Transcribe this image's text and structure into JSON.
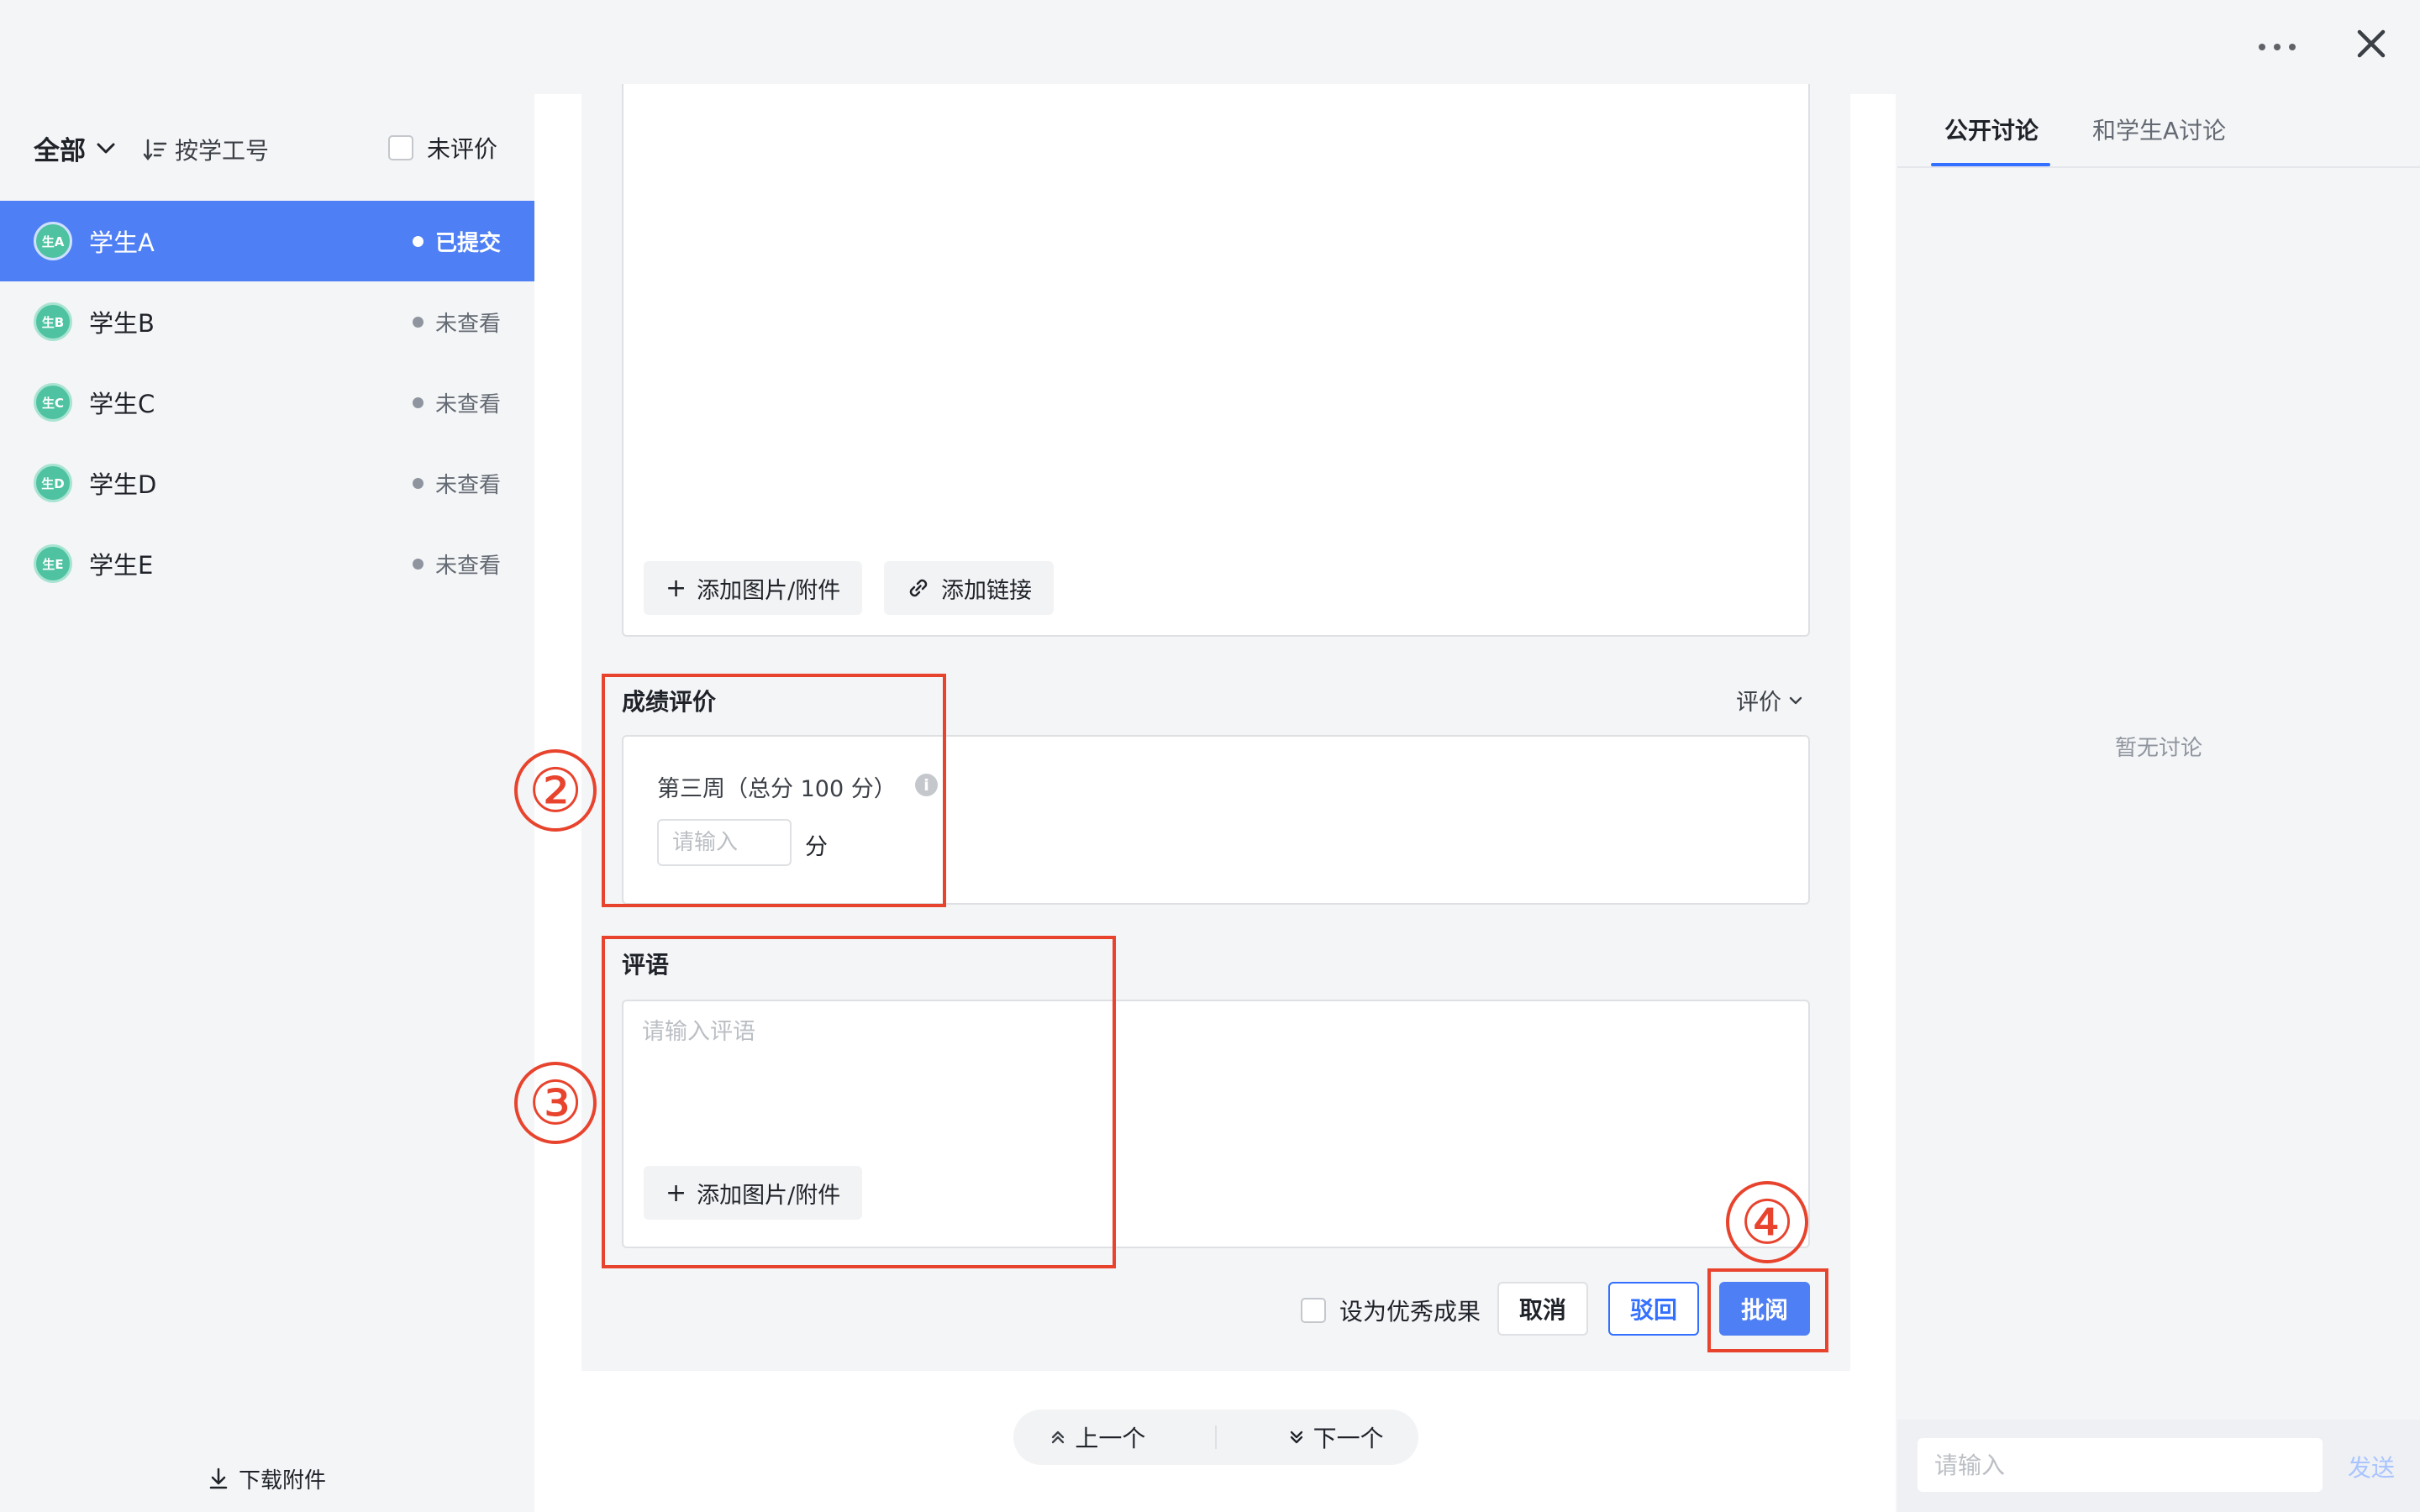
{
  "sidebar": {
    "filter_label": "全部",
    "sort_label": "按学工号",
    "unreviewed_label": "未评价",
    "students": [
      {
        "avatar": "生A",
        "name": "学生A",
        "status": "已提交"
      },
      {
        "avatar": "生B",
        "name": "学生B",
        "status": "未查看"
      },
      {
        "avatar": "生C",
        "name": "学生C",
        "status": "未查看"
      },
      {
        "avatar": "生D",
        "name": "学生D",
        "status": "未查看"
      },
      {
        "avatar": "生E",
        "name": "学生E",
        "status": "未查看"
      }
    ],
    "download_label": "下载附件"
  },
  "editor": {
    "add_attachment": "添加图片/附件",
    "add_link": "添加链接"
  },
  "grade": {
    "title": "成绩评价",
    "eval_dropdown": "评价",
    "item_label": "第三周（总分 100 分）",
    "score_placeholder": "请输入",
    "unit": "分"
  },
  "comment": {
    "title": "评语",
    "placeholder": "请输入评语",
    "add_attachment": "添加图片/附件"
  },
  "actions": {
    "excellent_label": "设为优秀成果",
    "cancel": "取消",
    "reject": "驳回",
    "review": "批阅"
  },
  "pager": {
    "prev": "上一个",
    "next": "下一个"
  },
  "annotations": {
    "step2": "②",
    "step3": "③",
    "step4": "④",
    "color": "#e8432d"
  },
  "discussion": {
    "tab_public": "公开讨论",
    "tab_student": "和学生A讨论",
    "empty": "暂无讨论",
    "input_placeholder": "请输入",
    "send": "发送"
  },
  "colors": {
    "primary": "#4e7ff5",
    "avatar": "#4fc3a1"
  }
}
